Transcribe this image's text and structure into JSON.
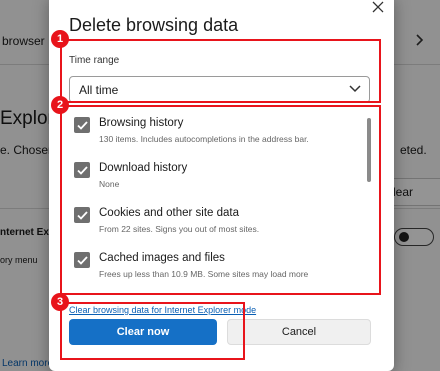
{
  "background": {
    "browser_label": "browser",
    "explorer_heading": "Explore",
    "chosen_text": "e. Chosen",
    "deleted_text": "eted.",
    "clear_button": "lear",
    "ie_label": "nternet Exp",
    "history_menu": "ory menu",
    "learn_more": "Learn more"
  },
  "dialog": {
    "title": "Delete browsing data",
    "close_icon": "close-icon",
    "time_range": {
      "label": "Time range",
      "selected": "All time"
    },
    "items": [
      {
        "title": "Browsing history",
        "description": "130 items. Includes autocompletions in the address bar.",
        "checked": true
      },
      {
        "title": "Download history",
        "description": "None",
        "checked": true
      },
      {
        "title": "Cookies and other site data",
        "description": "From 22 sites. Signs you out of most sites.",
        "checked": true
      },
      {
        "title": "Cached images and files",
        "description": "Frees up less than 10.9 MB. Some sites may load more",
        "checked": true
      }
    ],
    "ie_link": "Clear browsing data for Internet Explorer mode",
    "clear_button": "Clear now",
    "cancel_button": "Cancel"
  },
  "annotations": {
    "badges": [
      "1",
      "2",
      "3"
    ],
    "color": "#e8141b"
  },
  "colors": {
    "accent": "#1570c6",
    "checkbox": "#6f6f6f",
    "link": "#0a5fb4"
  }
}
